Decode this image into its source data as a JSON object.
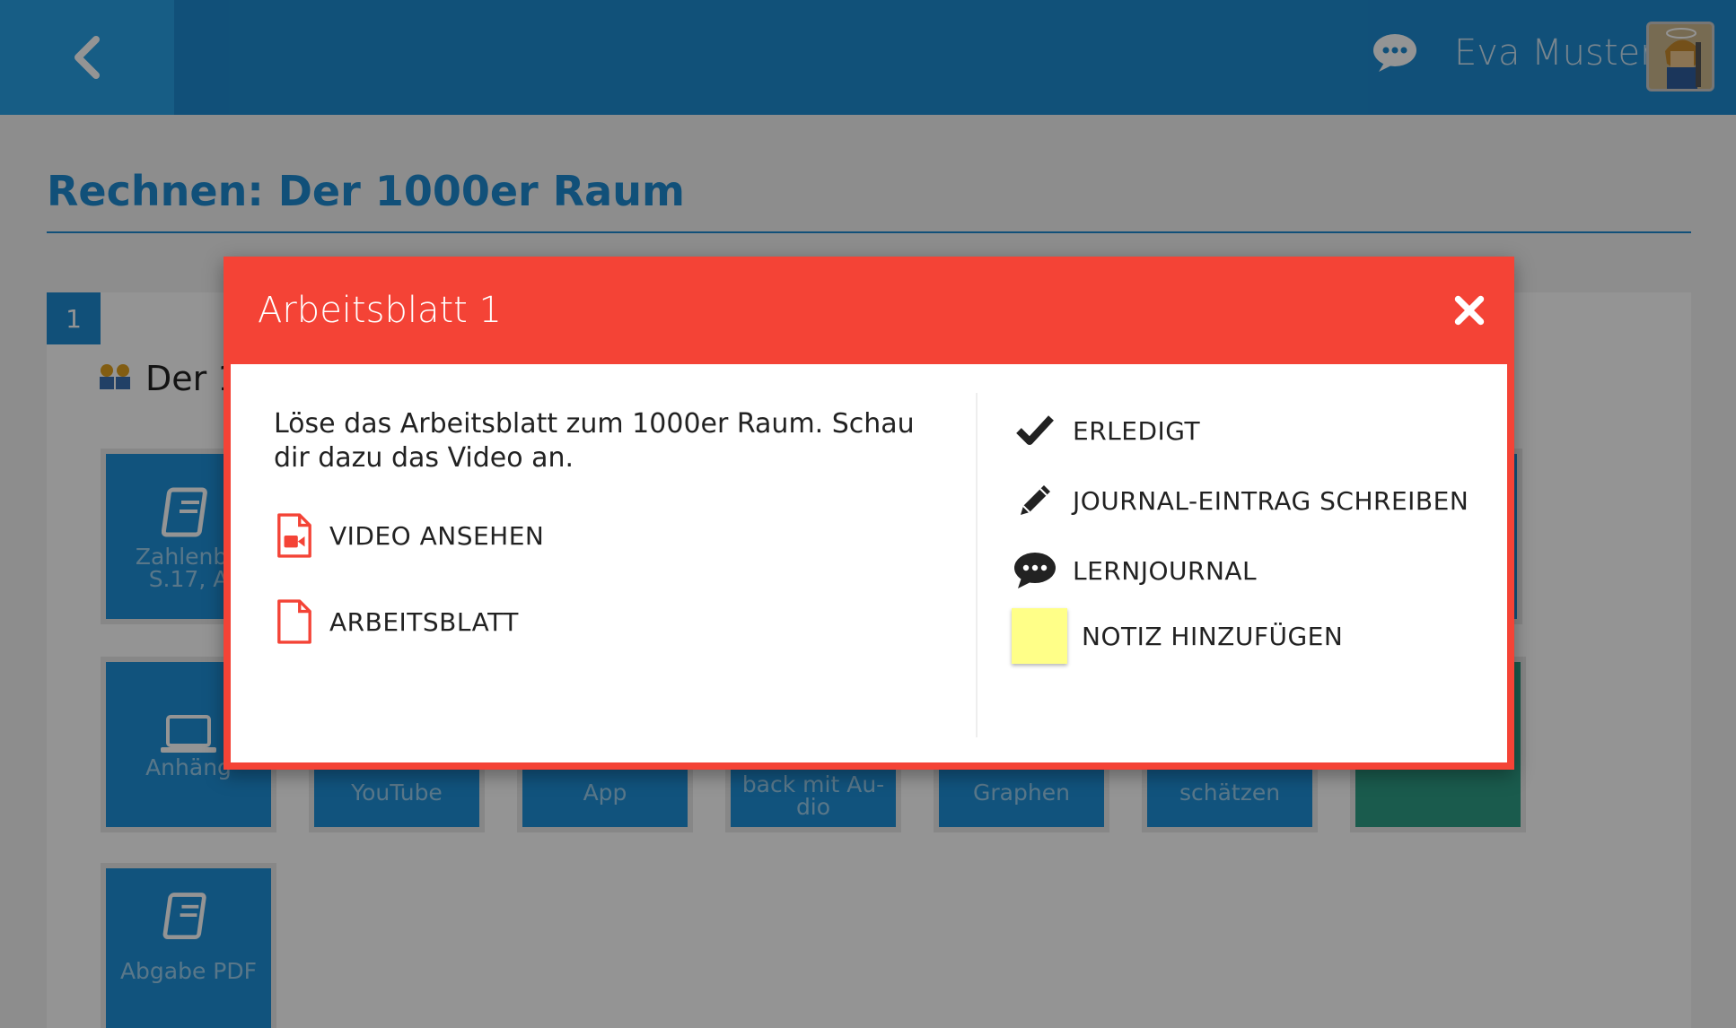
{
  "header": {
    "user_name": "Eva Muster"
  },
  "page": {
    "title": "Rechnen: Der 1000er Raum",
    "section_number": "1",
    "section_label_partial": "Der 1"
  },
  "tiles": [
    {
      "label": "Zahlenbu\nS.17, A",
      "icon": "book-icon"
    },
    {
      "label": "Anhäng",
      "icon": "laptop-icon"
    },
    {
      "label": "YouTube",
      "icon": ""
    },
    {
      "label": "App",
      "icon": ""
    },
    {
      "label": "back mit Au-\ndio",
      "icon": ""
    },
    {
      "label": "Graphen",
      "icon": ""
    },
    {
      "label": "schätzen",
      "icon": ""
    },
    {
      "label": "",
      "icon": ""
    },
    {
      "label": "Abgabe PDF",
      "icon": "book-icon"
    }
  ],
  "modal": {
    "title": "Arbeitsblatt 1",
    "description": "Löse das Arbeitsblatt zum 1000er Raum. Schau dir dazu das Video an.",
    "links": [
      {
        "label": "VIDEO ANSEHEN",
        "icon": "video-file-icon"
      },
      {
        "label": "ARBEITSBLATT",
        "icon": "file-icon"
      }
    ],
    "actions": [
      {
        "label": "ERLEDIGT",
        "icon": "check-icon"
      },
      {
        "label": "JOURNAL-EINTRAG SCHREIBEN",
        "icon": "pencil-icon"
      },
      {
        "label": "LERNJOURNAL",
        "icon": "chat-bubble-icon"
      },
      {
        "label": "NOTIZ HINZUFÜGEN",
        "icon": "sticky-note-icon"
      }
    ]
  },
  "colors": {
    "brand_blue": "#1e8bd0",
    "modal_red": "#f44336",
    "note_yellow": "#ffff88",
    "tile_green": "#2e9e86"
  }
}
